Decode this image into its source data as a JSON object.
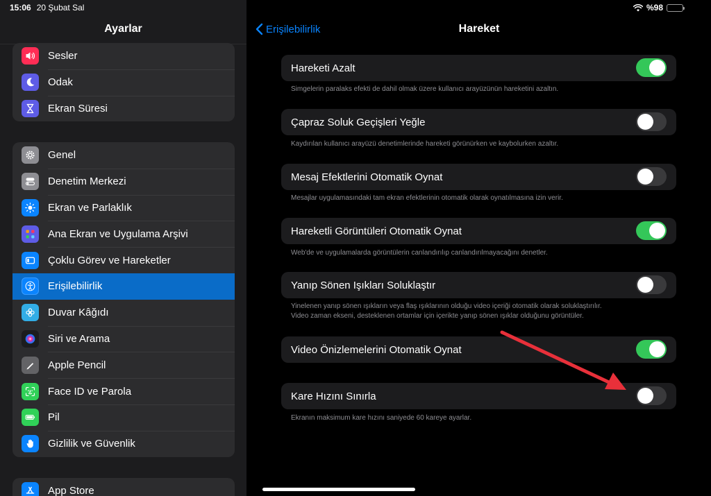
{
  "status": {
    "time": "15:06",
    "date": "20 Şubat Sal",
    "battery": "%98",
    "battery_level": 0.98
  },
  "sidebar": {
    "title": "Ayarlar",
    "group1": [
      {
        "label": "Sesler",
        "icon": "speaker-icon",
        "color": "#ff2d55"
      },
      {
        "label": "Odak",
        "icon": "moon-icon",
        "color": "#5e5ce6"
      },
      {
        "label": "Ekran Süresi",
        "icon": "hourglass-icon",
        "color": "#5e5ce6"
      }
    ],
    "group2": [
      {
        "label": "Genel",
        "icon": "gear-icon",
        "color": "#8e8e93"
      },
      {
        "label": "Denetim Merkezi",
        "icon": "switches-icon",
        "color": "#8e8e93"
      },
      {
        "label": "Ekran ve Parlaklık",
        "icon": "sun-icon",
        "color": "#0a84ff"
      },
      {
        "label": "Ana Ekran ve Uygulama Arşivi",
        "icon": "app-grid-icon",
        "color": "#5e5ce6"
      },
      {
        "label": "Çoklu Görev ve Hareketler",
        "icon": "multitasking-icon",
        "color": "#0a84ff"
      },
      {
        "label": "Erişilebilirlik",
        "icon": "accessibility-icon",
        "color": "#0a84ff"
      },
      {
        "label": "Duvar Kâğıdı",
        "icon": "flower-icon",
        "color": "#32ade6"
      },
      {
        "label": "Siri ve Arama",
        "icon": "siri-icon",
        "color": "#2c2c2e"
      },
      {
        "label": "Apple Pencil",
        "icon": "pencil-icon",
        "color": "#636366"
      },
      {
        "label": "Face ID ve Parola",
        "icon": "face-id-icon",
        "color": "#30d158"
      },
      {
        "label": "Pil",
        "icon": "battery-icon",
        "color": "#30d158"
      },
      {
        "label": "Gizlilik ve Güvenlik",
        "icon": "hand-icon",
        "color": "#0a84ff"
      }
    ],
    "group3": [
      {
        "label": "App Store",
        "icon": "app-store-icon",
        "color": "#0a84ff"
      }
    ],
    "selected": "Erişilebilirlik"
  },
  "detail": {
    "back_label": "Erişilebilirlik",
    "title": "Hareket",
    "settings": [
      {
        "label": "Hareketi Azalt",
        "on": true,
        "footer": "Simgelerin paralaks efekti de dahil olmak üzere kullanıcı arayüzünün hareketini azaltın."
      },
      {
        "label": "Çapraz Soluk Geçişleri Yeğle",
        "on": false,
        "footer": "Kaydırılan kullanıcı arayüzü denetimlerinde hareketi görünürken ve kaybolurken azaltır."
      },
      {
        "label": "Mesaj Efektlerini Otomatik Oynat",
        "on": false,
        "footer": "Mesajlar uygulamasındaki tam ekran efektlerinin otomatik olarak oynatılmasına izin verir."
      },
      {
        "label": "Hareketli Görüntüleri Otomatik Oynat",
        "on": true,
        "footer": "Web'de ve uygulamalarda görüntülerin canlandırılıp canlandırılmayacağını denetler."
      },
      {
        "label": "Yanıp Sönen Işıkları Soluklaştır",
        "on": false,
        "footer": "Yinelenen yanıp sönen ışıkların veya flaş ışıklarının olduğu video içeriği otomatik olarak soluklaştırılır.",
        "footer2": "Video zaman ekseni, desteklenen ortamlar için içerikte yanıp sönen ışıklar olduğunu görüntüler."
      },
      {
        "label": "Video Önizlemelerini Otomatik Oynat",
        "on": true
      },
      {
        "label": "Kare Hızını Sınırla",
        "on": false,
        "footer": "Ekranın maksimum kare hızını saniyede 60 kareye ayarlar."
      }
    ]
  },
  "annotation": {
    "arrow_color": "#e8303a"
  }
}
